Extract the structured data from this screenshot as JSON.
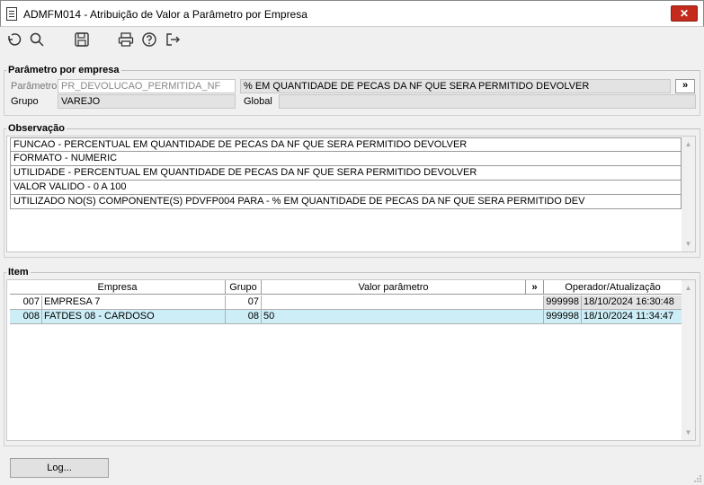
{
  "window": {
    "title": "ADMFM014 - Atribuição de Valor a Parâmetro por Empresa",
    "close": "✕"
  },
  "param": {
    "legend": "Parâmetro por empresa",
    "label_param": "Parâmetro",
    "param_value": "PR_DEVOLUCAO_PERMITIDA_NF",
    "param_desc": "% EM QUANTIDADE DE PECAS DA NF QUE SERA PERMITIDO DEVOLVER",
    "more": "»",
    "label_grupo": "Grupo",
    "grupo_value": "VAREJO",
    "label_global": "Global",
    "global_value": ""
  },
  "obs": {
    "legend": "Observação",
    "lines": [
      "FUNCAO - PERCENTUAL EM QUANTIDADE DE PECAS DA NF QUE SERA PERMITIDO DEVOLVER",
      "FORMATO - NUMERIC",
      "UTILIDADE - PERCENTUAL EM QUANTIDADE DE PECAS DA NF QUE SERA PERMITIDO DEVOLVER",
      "VALOR VALIDO - 0 A 100",
      "UTILIZADO NO(S) COMPONENTE(S) PDVFP004 PARA  - % EM QUANTIDADE DE PECAS DA NF QUE SERA PERMITIDO DEV"
    ]
  },
  "item": {
    "legend": "Item",
    "headers": {
      "empresa": "Empresa",
      "grupo": "Grupo",
      "valor": "Valor parâmetro",
      "more": "»",
      "operador": "Operador/Atualização"
    },
    "rows": [
      {
        "code": "007",
        "name": "EMPRESA 7",
        "grupo": "07",
        "valor": "",
        "op": "999998",
        "data": "18/10/2024 16:30:48"
      },
      {
        "code": "008",
        "name": "FATDES 08 - CARDOSO",
        "grupo": "08",
        "valor": "50",
        "op": "999998",
        "data": "18/10/2024 11:34:47"
      }
    ]
  },
  "footer": {
    "log": "Log..."
  }
}
